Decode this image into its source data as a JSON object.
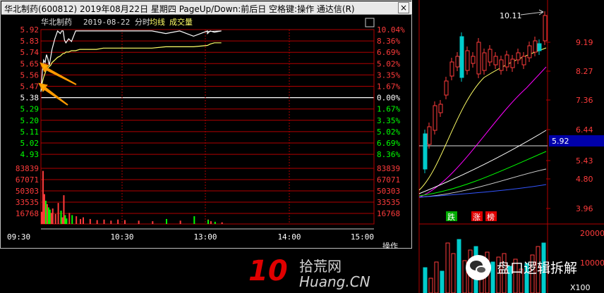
{
  "window": {
    "title": "华北制药(600812)  2019年08月22日 星期四 PageUp/Down:前后日 空格键:操作 通达信(R)",
    "close_label": "×"
  },
  "chart_header": {
    "stock_name": "华北制药",
    "date_label": "2019-08-22 分时",
    "avg_label": "均线",
    "volume_label": "成交量"
  },
  "price_ticks_left": [
    "5.92",
    "5.83",
    "5.74",
    "5.65",
    "5.56",
    "5.47",
    "5.38",
    "5.29",
    "5.20",
    "5.11",
    "5.02",
    "4.93"
  ],
  "price_ticks_right": [
    "10.04%",
    "8.36%",
    "6.69%",
    "5.02%",
    "3.35%",
    "1.67%",
    "0.00%",
    "1.67%",
    "3.35%",
    "5.02%",
    "6.69%",
    "8.36%"
  ],
  "volume_ticks": [
    "83839",
    "67071",
    "50303",
    "33535",
    "16768"
  ],
  "time_labels": [
    "09:30",
    "10:30",
    "13:00",
    "14:00",
    "15:00"
  ],
  "ops_label": "操作",
  "colors": {
    "up": "#ff3b3b",
    "down": "#00cccc",
    "avg": "#ffff66",
    "grid": "#b00000",
    "zero": "#ffffff"
  },
  "daily": {
    "high_label": "10.11",
    "current_price": "5.92",
    "price_ticks": [
      "9.19",
      "8.27",
      "7.36",
      "6.44",
      "5.43",
      "4.80",
      "3.96"
    ],
    "vol_ticks": [
      "20000",
      "10000"
    ],
    "vol_mult": "X100",
    "badges": [
      "跌",
      "涨",
      "榜"
    ]
  },
  "watermark": {
    "logo_number": "10",
    "site_name": "拾荒网",
    "site_url": "Huang.CN",
    "wechat_name": "盘口逻辑拆解"
  },
  "chart_data": {
    "type": "line",
    "prev_close": 5.38,
    "ylim": [
      4.88,
      5.93
    ],
    "x": [
      "09:30",
      "09:31",
      "09:32",
      "09:33",
      "09:34",
      "09:35",
      "09:36",
      "09:37",
      "09:38",
      "09:40",
      "09:42",
      "09:44",
      "09:45",
      "09:46",
      "09:47",
      "09:48",
      "09:50",
      "09:52",
      "09:55",
      "09:58",
      "10:00",
      "10:05",
      "10:10",
      "10:15",
      "10:20",
      "10:25",
      "10:30",
      "10:40",
      "10:50",
      "11:00",
      "11:10",
      "11:20",
      "11:30",
      "13:00",
      "13:02",
      "13:05",
      "13:10"
    ],
    "price": [
      5.46,
      5.62,
      5.7,
      5.68,
      5.74,
      5.71,
      5.66,
      5.72,
      5.78,
      5.86,
      5.92,
      5.9,
      5.92,
      5.92,
      5.85,
      5.83,
      5.86,
      5.84,
      5.92,
      5.92,
      5.92,
      5.92,
      5.92,
      5.92,
      5.92,
      5.92,
      5.92,
      5.92,
      5.92,
      5.9,
      5.92,
      5.88,
      5.92,
      5.9,
      5.92,
      5.91,
      5.92
    ],
    "avg": [
      5.46,
      5.53,
      5.57,
      5.6,
      5.63,
      5.64,
      5.65,
      5.66,
      5.68,
      5.7,
      5.72,
      5.73,
      5.74,
      5.75,
      5.75,
      5.76,
      5.76,
      5.77,
      5.77,
      5.78,
      5.78,
      5.78,
      5.78,
      5.79,
      5.79,
      5.79,
      5.79,
      5.79,
      5.79,
      5.8,
      5.8,
      5.8,
      5.81,
      5.81,
      5.82,
      5.83,
      5.83
    ],
    "volume_ylim": [
      0,
      100607
    ],
    "volume": [
      22000,
      96000,
      54000,
      42000,
      36000,
      30000,
      26000,
      20000,
      28000,
      18000,
      38000,
      24000,
      12000,
      52000,
      16000,
      10000,
      20000,
      16000,
      14000,
      9000,
      12000,
      9000,
      7000,
      8000,
      6000,
      8000,
      7000,
      6000,
      5000,
      9000,
      6000,
      14000,
      8000,
      7000,
      5000,
      4000,
      3000
    ]
  }
}
